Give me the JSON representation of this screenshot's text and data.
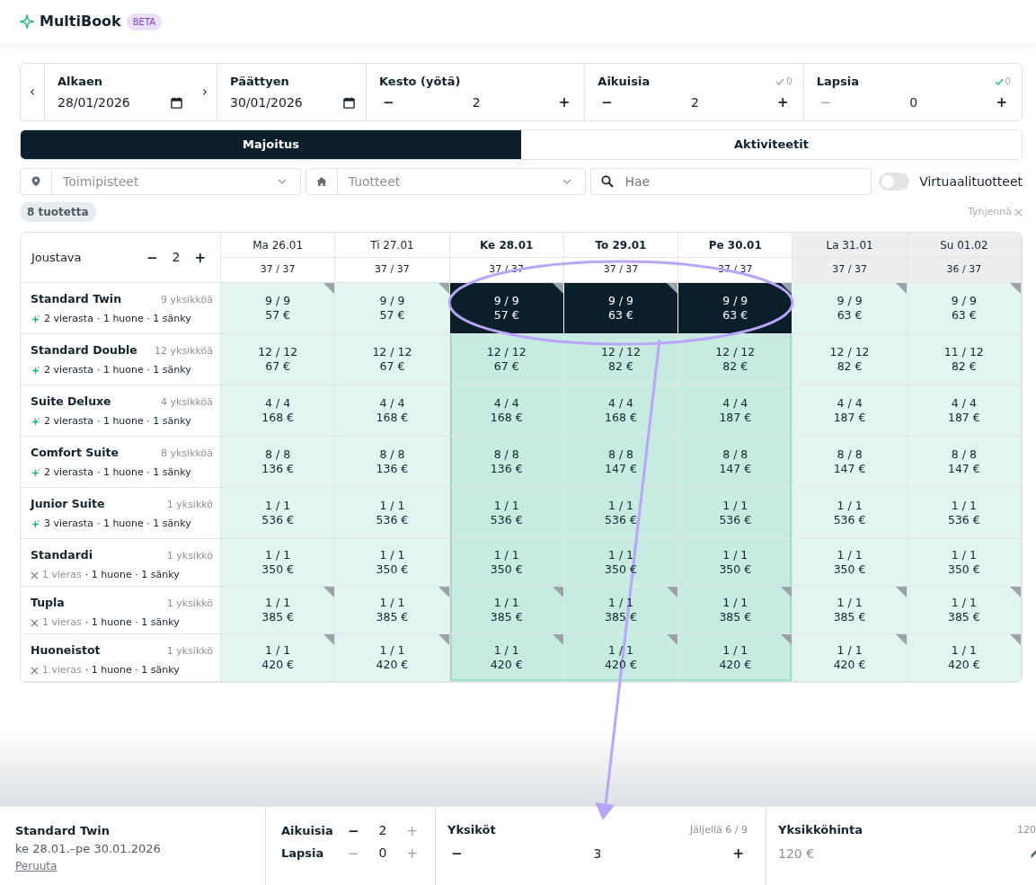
{
  "app": {
    "name": "MultiBook",
    "badge": "BETA"
  },
  "controls": {
    "prev": "‹",
    "next": "›",
    "start": {
      "label": "Alkaen",
      "value": "28/01/2026"
    },
    "end": {
      "label": "Päättyen",
      "value": "30/01/2026"
    },
    "steppers": [
      {
        "label": "Kesto (yötä)",
        "value": "2",
        "minus": "−",
        "plus": "+",
        "minus_disabled": false
      },
      {
        "label": "Aikuisia",
        "value": "2",
        "minus": "−",
        "plus": "+",
        "minus_disabled": false,
        "check": {
          "text": "0",
          "ok": false
        }
      },
      {
        "label": "Lapsia",
        "value": "0",
        "minus": "−",
        "plus": "+",
        "minus_disabled": true,
        "check": {
          "text": "0",
          "ok": true
        }
      }
    ]
  },
  "tabs": [
    {
      "label": "Majoitus",
      "selected": true
    },
    {
      "label": "Aktiviteetit",
      "selected": false
    }
  ],
  "filters": {
    "locations": {
      "placeholder": "Toimipisteet"
    },
    "products": {
      "placeholder": "Tuotteet"
    },
    "search": {
      "placeholder": "Hae"
    },
    "virtual": {
      "label": "Virtuaalituotteet",
      "on": false
    }
  },
  "count": "8 tuotetta",
  "clear": "Tyhjennä",
  "grid": {
    "flex": {
      "label": "Joustava",
      "value": "2",
      "minus": "−",
      "plus": "+"
    },
    "days": [
      {
        "label": "Ma 26.01",
        "count": "37 / 37",
        "selected": false,
        "weekend": false
      },
      {
        "label": "Ti 27.01",
        "count": "37 / 37",
        "selected": false,
        "weekend": false
      },
      {
        "label": "Ke 28.01",
        "count": "37 / 37",
        "selected": true,
        "weekend": false
      },
      {
        "label": "To 29.01",
        "count": "37 / 37",
        "selected": true,
        "weekend": false
      },
      {
        "label": "Pe 30.01",
        "count": "37 / 37",
        "selected": true,
        "weekend": false
      },
      {
        "label": "La 31.01",
        "count": "37 / 37",
        "selected": false,
        "weekend": true
      },
      {
        "label": "Su 01.02",
        "count": "36 / 37",
        "selected": false,
        "weekend": true
      }
    ],
    "rows": [
      {
        "name": "Standard Twin",
        "units": "9 yksikköä",
        "kind": "sparkle",
        "guests": "2 vierasta",
        "layout": "· 1 huone · 1 sänky",
        "cells": [
          {
            "avail": "9 / 9",
            "price": "57 €",
            "selected": false,
            "marked": true
          },
          {
            "avail": "9 / 9",
            "price": "57 €",
            "selected": false,
            "marked": true
          },
          {
            "avail": "9 / 9",
            "price": "57 €",
            "selected": true,
            "marked": true
          },
          {
            "avail": "9 / 9",
            "price": "63 €",
            "selected": true,
            "marked": true
          },
          {
            "avail": "9 / 9",
            "price": "63 €",
            "selected": true,
            "marked": true
          },
          {
            "avail": "9 / 9",
            "price": "63 €",
            "selected": false,
            "marked": true
          },
          {
            "avail": "9 / 9",
            "price": "63 €",
            "selected": false,
            "marked": true
          }
        ]
      },
      {
        "name": "Standard Double",
        "units": "12 yksikköä",
        "kind": "sparkle",
        "guests": "2 vierasta",
        "layout": "· 1 huone · 1 sänky",
        "cells": [
          {
            "avail": "12 / 12",
            "price": "67 €",
            "selected": false,
            "marked": false
          },
          {
            "avail": "12 / 12",
            "price": "67 €",
            "selected": false,
            "marked": false
          },
          {
            "avail": "12 / 12",
            "price": "67 €",
            "selected": false,
            "marked": false
          },
          {
            "avail": "12 / 12",
            "price": "82 €",
            "selected": false,
            "marked": false
          },
          {
            "avail": "12 / 12",
            "price": "82 €",
            "selected": false,
            "marked": false
          },
          {
            "avail": "12 / 12",
            "price": "82 €",
            "selected": false,
            "marked": false
          },
          {
            "avail": "11 / 12",
            "price": "82 €",
            "selected": false,
            "marked": false
          }
        ]
      },
      {
        "name": "Suite Deluxe",
        "units": "4 yksikköä",
        "kind": "sparkle",
        "guests": "2 vierasta",
        "layout": "· 1 huone · 1 sänky",
        "cells": [
          {
            "avail": "4 / 4",
            "price": "168 €",
            "selected": false,
            "marked": false
          },
          {
            "avail": "4 / 4",
            "price": "168 €",
            "selected": false,
            "marked": false
          },
          {
            "avail": "4 / 4",
            "price": "168 €",
            "selected": false,
            "marked": false
          },
          {
            "avail": "4 / 4",
            "price": "168 €",
            "selected": false,
            "marked": false
          },
          {
            "avail": "4 / 4",
            "price": "187 €",
            "selected": false,
            "marked": false
          },
          {
            "avail": "4 / 4",
            "price": "187 €",
            "selected": false,
            "marked": false
          },
          {
            "avail": "4 / 4",
            "price": "187 €",
            "selected": false,
            "marked": false
          }
        ]
      },
      {
        "name": "Comfort Suite",
        "units": "8 yksikköä",
        "kind": "sparkle",
        "guests": "2 vierasta",
        "layout": "· 1 huone · 1 sänky",
        "cells": [
          {
            "avail": "8 / 8",
            "price": "136 €",
            "selected": false,
            "marked": false
          },
          {
            "avail": "8 / 8",
            "price": "136 €",
            "selected": false,
            "marked": false
          },
          {
            "avail": "8 / 8",
            "price": "136 €",
            "selected": false,
            "marked": false
          },
          {
            "avail": "8 / 8",
            "price": "147 €",
            "selected": false,
            "marked": false
          },
          {
            "avail": "8 / 8",
            "price": "147 €",
            "selected": false,
            "marked": false
          },
          {
            "avail": "8 / 8",
            "price": "147 €",
            "selected": false,
            "marked": false
          },
          {
            "avail": "8 / 8",
            "price": "147 €",
            "selected": false,
            "marked": false
          }
        ]
      },
      {
        "name": "Junior Suite",
        "units": "1 yksikkö",
        "kind": "sparkle",
        "guests": "3 vierasta",
        "layout": "· 1 huone · 1 sänky",
        "cells": [
          {
            "avail": "1 / 1",
            "price": "536 €",
            "selected": false,
            "marked": false
          },
          {
            "avail": "1 / 1",
            "price": "536 €",
            "selected": false,
            "marked": false
          },
          {
            "avail": "1 / 1",
            "price": "536 €",
            "selected": false,
            "marked": false
          },
          {
            "avail": "1 / 1",
            "price": "536 €",
            "selected": false,
            "marked": false
          },
          {
            "avail": "1 / 1",
            "price": "536 €",
            "selected": false,
            "marked": false
          },
          {
            "avail": "1 / 1",
            "price": "536 €",
            "selected": false,
            "marked": false
          },
          {
            "avail": "1 / 1",
            "price": "536 €",
            "selected": false,
            "marked": false
          }
        ]
      },
      {
        "name": "Standardi",
        "units": "1 yksikkö",
        "kind": "cross",
        "guests": "1 vieras",
        "layout": "· 1 huone · 1 sänky",
        "cells": [
          {
            "avail": "1 / 1",
            "price": "350 €",
            "selected": false,
            "marked": false
          },
          {
            "avail": "1 / 1",
            "price": "350 €",
            "selected": false,
            "marked": false
          },
          {
            "avail": "1 / 1",
            "price": "350 €",
            "selected": false,
            "marked": false
          },
          {
            "avail": "1 / 1",
            "price": "350 €",
            "selected": false,
            "marked": false
          },
          {
            "avail": "1 / 1",
            "price": "350 €",
            "selected": false,
            "marked": false
          },
          {
            "avail": "1 / 1",
            "price": "350 €",
            "selected": false,
            "marked": false
          },
          {
            "avail": "1 / 1",
            "price": "350 €",
            "selected": false,
            "marked": false
          }
        ]
      },
      {
        "name": "Tupla",
        "units": "1 yksikkö",
        "kind": "cross",
        "guests": "1 vieras",
        "layout": "· 1 huone · 1 sänky",
        "cells": [
          {
            "avail": "1 / 1",
            "price": "385 €",
            "selected": false,
            "marked": true
          },
          {
            "avail": "1 / 1",
            "price": "385 €",
            "selected": false,
            "marked": true
          },
          {
            "avail": "1 / 1",
            "price": "385 €",
            "selected": false,
            "marked": true
          },
          {
            "avail": "1 / 1",
            "price": "385 €",
            "selected": false,
            "marked": true
          },
          {
            "avail": "1 / 1",
            "price": "385 €",
            "selected": false,
            "marked": true
          },
          {
            "avail": "1 / 1",
            "price": "385 €",
            "selected": false,
            "marked": true
          },
          {
            "avail": "1 / 1",
            "price": "385 €",
            "selected": false,
            "marked": true
          }
        ]
      },
      {
        "name": "Huoneistot",
        "units": "1 yksikkö",
        "kind": "cross",
        "guests": "1 vieras",
        "layout": "· 1 huone · 1 sänky",
        "cells": [
          {
            "avail": "1 / 1",
            "price": "420 €",
            "selected": false,
            "marked": true
          },
          {
            "avail": "1 / 1",
            "price": "420 €",
            "selected": false,
            "marked": true
          },
          {
            "avail": "1 / 1",
            "price": "420 €",
            "selected": false,
            "marked": true
          },
          {
            "avail": "1 / 1",
            "price": "420 €",
            "selected": false,
            "marked": true
          },
          {
            "avail": "1 / 1",
            "price": "420 €",
            "selected": false,
            "marked": true
          },
          {
            "avail": "1 / 1",
            "price": "420 €",
            "selected": false,
            "marked": true
          },
          {
            "avail": "1 / 1",
            "price": "420 €",
            "selected": false,
            "marked": true
          }
        ]
      }
    ]
  },
  "booking": {
    "title": "Standard Twin",
    "dates": "ke 28.01.–pe 30.01.2026",
    "cancel": "Peruuta",
    "guests": [
      {
        "label": "Aikuisia",
        "value": "2",
        "minus": "−",
        "plus": "+",
        "minus_disabled": false,
        "plus_disabled": true
      },
      {
        "label": "Lapsia",
        "value": "0",
        "minus": "−",
        "plus": "+",
        "minus_disabled": true,
        "plus_disabled": true
      }
    ],
    "units": {
      "label": "Yksiköt",
      "remaining": "Jäljellä 6 / 9",
      "value": "3",
      "minus": "−",
      "plus": "+"
    },
    "price": {
      "label": "Yksikköhinta",
      "note": "120",
      "value": "120 €"
    }
  }
}
